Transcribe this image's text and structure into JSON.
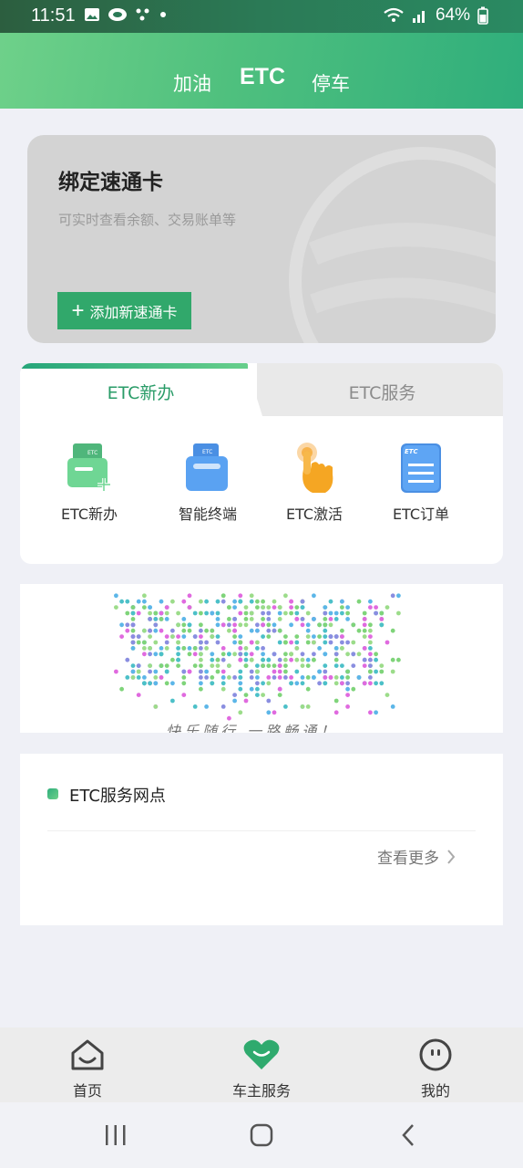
{
  "status": {
    "time": "11:51",
    "battery": "64%"
  },
  "top_tabs": [
    {
      "label": "加油",
      "active": false
    },
    {
      "label": "ETC",
      "active": true
    },
    {
      "label": "停车",
      "active": false
    }
  ],
  "bind_card": {
    "title": "绑定速通卡",
    "subtitle": "可实时查看余额、交易账单等",
    "button_label": "添加新速通卡"
  },
  "service_panel": {
    "tabs": [
      {
        "label": "ETC新办",
        "active": true
      },
      {
        "label": "ETC服务",
        "active": false
      }
    ],
    "items": [
      {
        "label": "ETC新办",
        "icon": "card-add-icon"
      },
      {
        "label": "智能终端",
        "icon": "terminal-icon"
      },
      {
        "label": "ETC激活",
        "icon": "tap-hand-icon"
      },
      {
        "label": "ETC订单",
        "icon": "order-clipboard-icon"
      }
    ]
  },
  "banner": {
    "text": "快乐随行 一路畅通！"
  },
  "service_points": {
    "title": "ETC服务网点",
    "more_label": "查看更多"
  },
  "bottom_nav": [
    {
      "label": "首页",
      "icon": "home-icon",
      "active": false
    },
    {
      "label": "车主服务",
      "icon": "heart-icon",
      "active": true
    },
    {
      "label": "我的",
      "icon": "profile-face-icon",
      "active": false
    }
  ],
  "colors": {
    "brand_green": "#31a86b",
    "tab_active_text": "#2a9c68"
  }
}
